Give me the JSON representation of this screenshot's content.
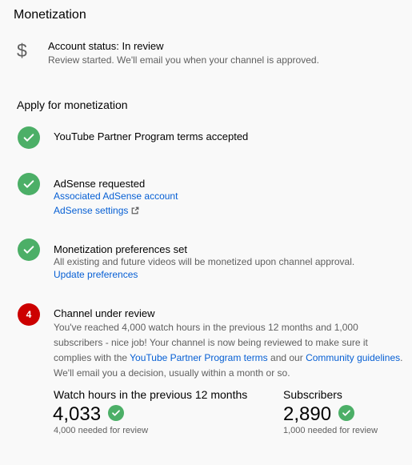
{
  "page": {
    "title": "Monetization"
  },
  "account": {
    "icon": "dollar-icon",
    "icon_glyph": "$",
    "status": "Account status: In review",
    "description": "Review started. We'll email you when your channel is approved."
  },
  "apply": {
    "heading": "Apply for monetization",
    "steps": [
      {
        "title": "YouTube Partner Program terms accepted",
        "state": "done"
      },
      {
        "title": "AdSense requested",
        "state": "done",
        "links": [
          "Associated AdSense account",
          "AdSense settings"
        ]
      },
      {
        "title": "Monetization preferences set",
        "state": "done",
        "description": "All existing and future videos will be monetized upon channel approval.",
        "links": [
          "Update preferences"
        ]
      },
      {
        "title": "Channel under review",
        "state": "current",
        "number": "4",
        "description_parts": {
          "p1": "You've reached 4,000 watch hours in the previous 12 months and 1,000 subscribers - nice job! Your channel is now being reviewed to make sure it complies with the ",
          "link1": "YouTube Partner Program terms",
          "p2": " and our ",
          "link2": "Community guidelines",
          "p3": ". We'll email you a decision, usually within a month or so."
        }
      }
    ]
  },
  "stats": {
    "watch_hours": {
      "label": "Watch hours in the previous 12 months",
      "value": "4,033",
      "note": "4,000 needed for review"
    },
    "subscribers": {
      "label": "Subscribers",
      "value": "2,890",
      "note": "1,000 needed for review"
    }
  },
  "colors": {
    "check": "#4caf67",
    "badge": "#cc0000",
    "link": "#065fd4",
    "secondary_text": "#606060"
  }
}
